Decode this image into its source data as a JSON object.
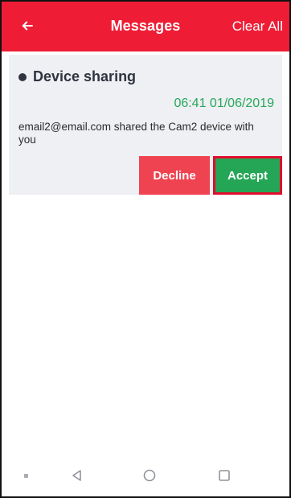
{
  "header": {
    "title": "Messages",
    "clear_all_label": "Clear All",
    "back_icon": "arrow-left-icon",
    "background_color": "#ee1d35"
  },
  "notification": {
    "title": "Device sharing",
    "timestamp": "06:41 01/06/2019",
    "message": "email2@email.com shared the Cam2 device with you",
    "decline_label": "Decline",
    "accept_label": "Accept",
    "accept_color": "#24a656",
    "decline_color": "#f04351",
    "timestamp_color": "#26a75a"
  },
  "nav": {
    "recents_icon": "small-square-icon",
    "back_icon": "triangle-back-icon",
    "home_icon": "circle-home-icon",
    "overview_icon": "square-overview-icon"
  }
}
